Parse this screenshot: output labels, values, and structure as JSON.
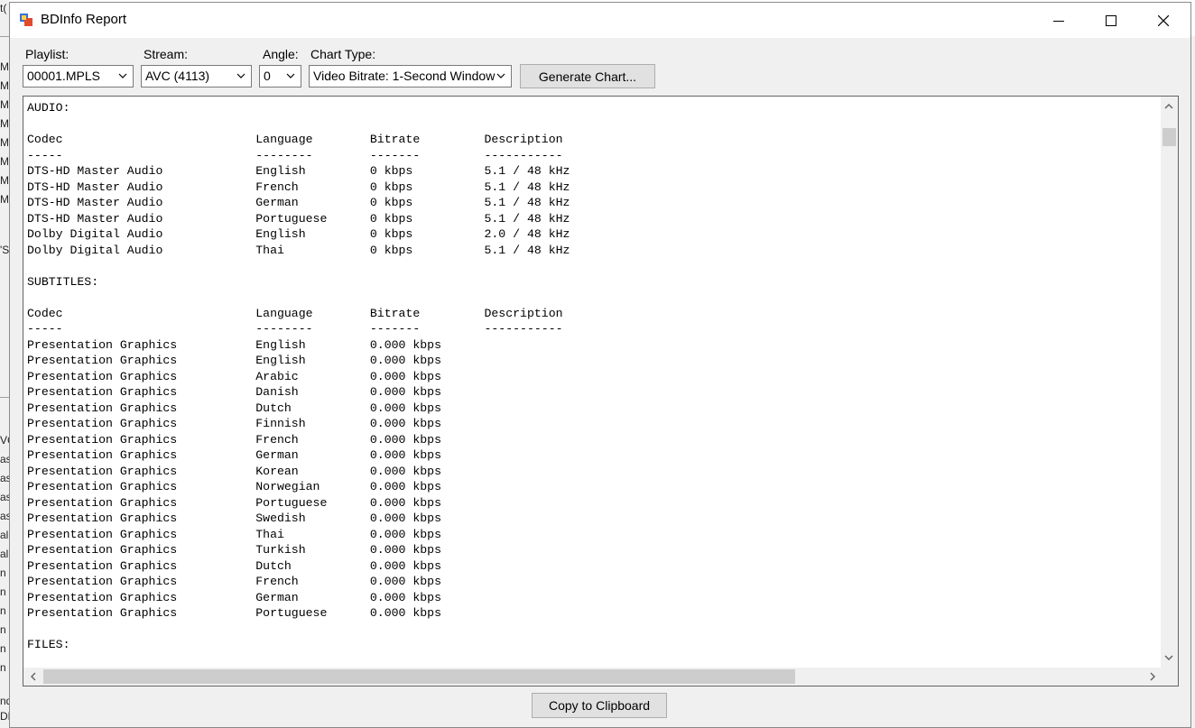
{
  "window": {
    "title": "BDInfo Report"
  },
  "controls": {
    "playlist": {
      "label": "Playlist:",
      "value": "00001.MPLS"
    },
    "stream": {
      "label": "Stream:",
      "value": "AVC (4113)"
    },
    "angle": {
      "label": "Angle:",
      "value": "0"
    },
    "chart_type": {
      "label": "Chart Type:",
      "value": "Video Bitrate: 1-Second Window"
    },
    "generate_button": "Generate Chart..."
  },
  "report": {
    "lines": [
      "AUDIO:",
      "",
      "Codec                           Language        Bitrate         Description",
      "-----                           --------        -------         -----------",
      "DTS-HD Master Audio             English         0 kbps          5.1 / 48 kHz",
      "DTS-HD Master Audio             French          0 kbps          5.1 / 48 kHz",
      "DTS-HD Master Audio             German          0 kbps          5.1 / 48 kHz",
      "DTS-HD Master Audio             Portuguese      0 kbps          5.1 / 48 kHz",
      "Dolby Digital Audio             English         0 kbps          2.0 / 48 kHz",
      "Dolby Digital Audio             Thai            0 kbps          5.1 / 48 kHz",
      "",
      "SUBTITLES:",
      "",
      "Codec                           Language        Bitrate         Description",
      "-----                           --------        -------         -----------",
      "Presentation Graphics           English         0.000 kbps",
      "Presentation Graphics           English         0.000 kbps",
      "Presentation Graphics           Arabic          0.000 kbps",
      "Presentation Graphics           Danish          0.000 kbps",
      "Presentation Graphics           Dutch           0.000 kbps",
      "Presentation Graphics           Finnish         0.000 kbps",
      "Presentation Graphics           French          0.000 kbps",
      "Presentation Graphics           German          0.000 kbps",
      "Presentation Graphics           Korean          0.000 kbps",
      "Presentation Graphics           Norwegian       0.000 kbps",
      "Presentation Graphics           Portuguese      0.000 kbps",
      "Presentation Graphics           Swedish         0.000 kbps",
      "Presentation Graphics           Thai            0.000 kbps",
      "Presentation Graphics           Turkish         0.000 kbps",
      "Presentation Graphics           Dutch           0.000 kbps",
      "Presentation Graphics           French          0.000 kbps",
      "Presentation Graphics           German          0.000 kbps",
      "Presentation Graphics           Portuguese      0.000 kbps",
      "",
      "FILES:"
    ]
  },
  "footer": {
    "copy_button": "Copy to Clipboard"
  },
  "background_fragments": [
    "t(",
    "MF",
    "MF",
    "MF",
    "MF",
    "MF",
    "MF",
    "MF",
    "'S",
    "VC",
    "as",
    "as",
    "as",
    "as",
    "al",
    "al",
    "n",
    "n",
    "n",
    "n",
    "n",
    "n",
    "nd",
    "DN"
  ],
  "icons": {
    "app": "bdinfo-app-icon",
    "minimize": "minimize-icon",
    "maximize": "maximize-icon",
    "close": "close-icon",
    "dropdown": "chevron-down-icon",
    "scroll_up": "chevron-up-icon",
    "scroll_down": "chevron-down-icon",
    "scroll_left": "chevron-left-icon",
    "scroll_right": "chevron-right-icon"
  }
}
